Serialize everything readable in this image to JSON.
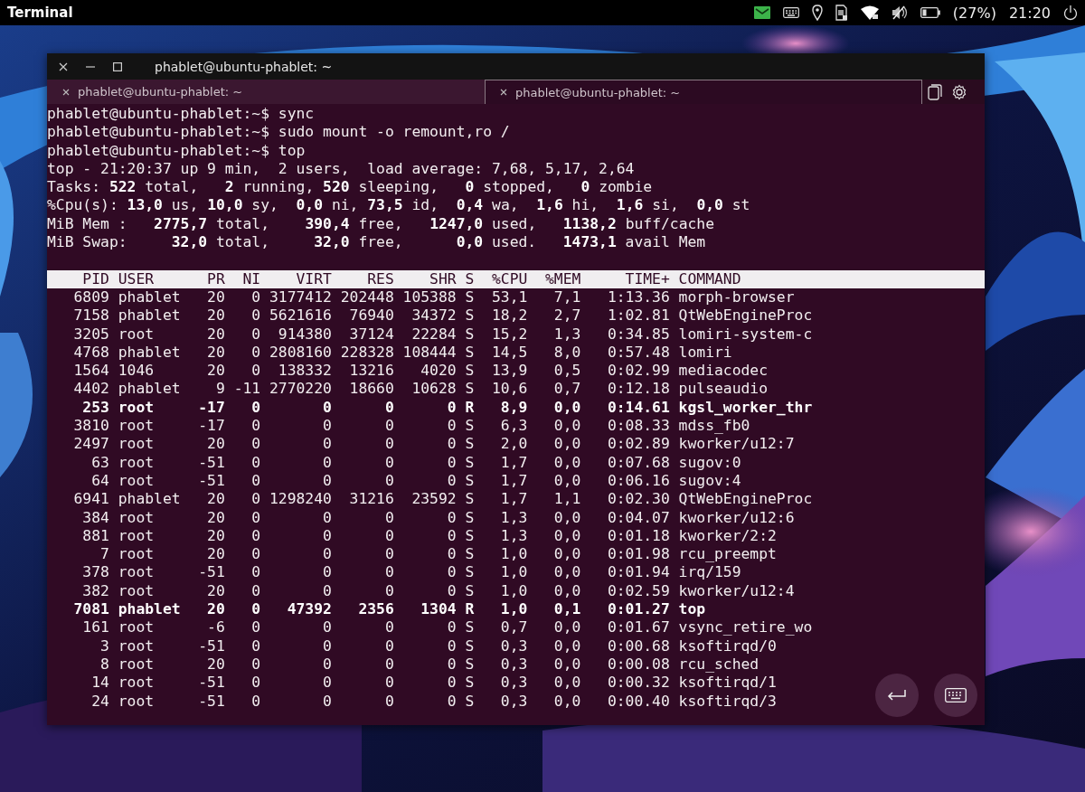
{
  "top_bar": {
    "app_title": "Terminal",
    "battery_text": "(27%)",
    "clock": "21:20"
  },
  "window": {
    "title": "phablet@ubuntu-phablet: ~"
  },
  "tabs": [
    {
      "label": "phablet@ubuntu-phablet: ~",
      "selected": false
    },
    {
      "label": "phablet@ubuntu-phablet: ~",
      "selected": true
    }
  ],
  "terminal": {
    "lines": [
      {
        "kind": "text",
        "text": "phablet@ubuntu-phablet:~$ sync"
      },
      {
        "kind": "text",
        "text": "phablet@ubuntu-phablet:~$ sudo mount -o remount,ro /"
      },
      {
        "kind": "text",
        "text": "phablet@ubuntu-phablet:~$ top"
      },
      {
        "kind": "text",
        "text": "top - 21:20:37 up 9 min,  2 users,  load average: 7,68, 5,17, 2,64"
      },
      {
        "kind": "text",
        "text": "Tasks: **522** total,   **2** running, **520** sleeping,   **0** stopped,   **0** zombie"
      },
      {
        "kind": "text",
        "text": "%Cpu(s): **13,0** us, **10,0** sy,  **0,0** ni, **73,5** id,  **0,4** wa,  **1,6** hi,  **1,6** si,  **0,0** st"
      },
      {
        "kind": "text",
        "text": "MiB Mem :   **2775,7** total,    **390,4** free,   **1247,0** used,   **1138,2** buff/cache"
      },
      {
        "kind": "text",
        "text": "MiB Swap:     **32,0** total,     **32,0** free,      **0,0** used.   **1473,1** avail Mem"
      },
      {
        "kind": "blank"
      }
    ],
    "table": {
      "columns": [
        "PID",
        "USER",
        "PR",
        "NI",
        "VIRT",
        "RES",
        "SHR",
        "S",
        "%CPU",
        "%MEM",
        "TIME+",
        "COMMAND"
      ],
      "rows": [
        {
          "bold": false,
          "cells": [
            "6809",
            "phablet",
            "20",
            "0",
            "3177412",
            "202448",
            "105388",
            "S",
            "53,1",
            "7,1",
            "1:13.36",
            "morph-browser"
          ]
        },
        {
          "bold": false,
          "cells": [
            "7158",
            "phablet",
            "20",
            "0",
            "5621616",
            "76940",
            "34372",
            "S",
            "18,2",
            "2,7",
            "1:02.81",
            "QtWebEngineProc"
          ]
        },
        {
          "bold": false,
          "cells": [
            "3205",
            "root",
            "20",
            "0",
            "914380",
            "37124",
            "22284",
            "S",
            "15,2",
            "1,3",
            "0:34.85",
            "lomiri-system-c"
          ]
        },
        {
          "bold": false,
          "cells": [
            "4768",
            "phablet",
            "20",
            "0",
            "2808160",
            "228328",
            "108444",
            "S",
            "14,5",
            "8,0",
            "0:57.48",
            "lomiri"
          ]
        },
        {
          "bold": false,
          "cells": [
            "1564",
            "1046",
            "20",
            "0",
            "138332",
            "13216",
            "4020",
            "S",
            "13,9",
            "0,5",
            "0:02.99",
            "mediacodec"
          ]
        },
        {
          "bold": false,
          "cells": [
            "4402",
            "phablet",
            "9",
            "-11",
            "2770220",
            "18660",
            "10628",
            "S",
            "10,6",
            "0,7",
            "0:12.18",
            "pulseaudio"
          ]
        },
        {
          "bold": true,
          "cells": [
            "253",
            "root",
            "-17",
            "0",
            "0",
            "0",
            "0",
            "R",
            "8,9",
            "0,0",
            "0:14.61",
            "kgsl_worker_thr"
          ]
        },
        {
          "bold": false,
          "cells": [
            "3810",
            "root",
            "-17",
            "0",
            "0",
            "0",
            "0",
            "S",
            "6,3",
            "0,0",
            "0:08.33",
            "mdss_fb0"
          ]
        },
        {
          "bold": false,
          "cells": [
            "2497",
            "root",
            "20",
            "0",
            "0",
            "0",
            "0",
            "S",
            "2,0",
            "0,0",
            "0:02.89",
            "kworker/u12:7"
          ]
        },
        {
          "bold": false,
          "cells": [
            "63",
            "root",
            "-51",
            "0",
            "0",
            "0",
            "0",
            "S",
            "1,7",
            "0,0",
            "0:07.68",
            "sugov:0"
          ]
        },
        {
          "bold": false,
          "cells": [
            "64",
            "root",
            "-51",
            "0",
            "0",
            "0",
            "0",
            "S",
            "1,7",
            "0,0",
            "0:06.16",
            "sugov:4"
          ]
        },
        {
          "bold": false,
          "cells": [
            "6941",
            "phablet",
            "20",
            "0",
            "1298240",
            "31216",
            "23592",
            "S",
            "1,7",
            "1,1",
            "0:02.30",
            "QtWebEngineProc"
          ]
        },
        {
          "bold": false,
          "cells": [
            "384",
            "root",
            "20",
            "0",
            "0",
            "0",
            "0",
            "S",
            "1,3",
            "0,0",
            "0:04.07",
            "kworker/u12:6"
          ]
        },
        {
          "bold": false,
          "cells": [
            "881",
            "root",
            "20",
            "0",
            "0",
            "0",
            "0",
            "S",
            "1,3",
            "0,0",
            "0:01.18",
            "kworker/2:2"
          ]
        },
        {
          "bold": false,
          "cells": [
            "7",
            "root",
            "20",
            "0",
            "0",
            "0",
            "0",
            "S",
            "1,0",
            "0,0",
            "0:01.98",
            "rcu_preempt"
          ]
        },
        {
          "bold": false,
          "cells": [
            "378",
            "root",
            "-51",
            "0",
            "0",
            "0",
            "0",
            "S",
            "1,0",
            "0,0",
            "0:01.94",
            "irq/159"
          ]
        },
        {
          "bold": false,
          "cells": [
            "382",
            "root",
            "20",
            "0",
            "0",
            "0",
            "0",
            "S",
            "1,0",
            "0,0",
            "0:02.59",
            "kworker/u12:4"
          ]
        },
        {
          "bold": true,
          "cells": [
            "7081",
            "phablet",
            "20",
            "0",
            "47392",
            "2356",
            "1304",
            "R",
            "1,0",
            "0,1",
            "0:01.27",
            "top"
          ]
        },
        {
          "bold": false,
          "cells": [
            "161",
            "root",
            "-6",
            "0",
            "0",
            "0",
            "0",
            "S",
            "0,7",
            "0,0",
            "0:01.67",
            "vsync_retire_wo"
          ]
        },
        {
          "bold": false,
          "cells": [
            "3",
            "root",
            "-51",
            "0",
            "0",
            "0",
            "0",
            "S",
            "0,3",
            "0,0",
            "0:00.68",
            "ksoftirqd/0"
          ]
        },
        {
          "bold": false,
          "cells": [
            "8",
            "root",
            "20",
            "0",
            "0",
            "0",
            "0",
            "S",
            "0,3",
            "0,0",
            "0:00.08",
            "rcu_sched"
          ]
        },
        {
          "bold": false,
          "cells": [
            "14",
            "root",
            "-51",
            "0",
            "0",
            "0",
            "0",
            "S",
            "0,3",
            "0,0",
            "0:00.32",
            "ksoftirqd/1"
          ]
        },
        {
          "bold": false,
          "cells": [
            "24",
            "root",
            "-51",
            "0",
            "0",
            "0",
            "0",
            "S",
            "0,3",
            "0,0",
            "0:00.40",
            "ksoftirqd/3"
          ]
        }
      ]
    }
  }
}
